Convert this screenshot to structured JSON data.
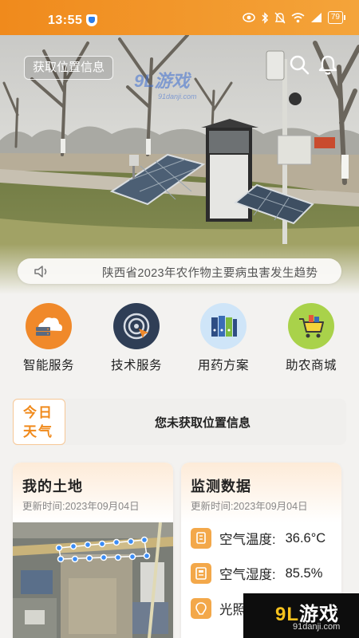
{
  "status_bar": {
    "time": "13:55",
    "battery": "79",
    "icons": [
      "eye-icon",
      "bluetooth-icon",
      "mute-icon",
      "wifi-icon",
      "signal-icon",
      "battery-icon"
    ]
  },
  "hero": {
    "location_button": "获取位置信息",
    "watermark_text": "9L游戏",
    "watermark_url": "91danji.com"
  },
  "notice": {
    "text": "陕西省2023年农作物主要病虫害发生趋势"
  },
  "services": [
    {
      "label": "智能服务",
      "icon": "cloud-server-icon",
      "color": "#f0892a"
    },
    {
      "label": "技术服务",
      "icon": "radar-cursor-icon",
      "color": "#2f3e56"
    },
    {
      "label": "用药方案",
      "icon": "binders-icon",
      "color": "#cfe5f8"
    },
    {
      "label": "助农商城",
      "icon": "shopping-cart-icon",
      "color": "#a9d24a"
    }
  ],
  "weather": {
    "badge_line1": "今日",
    "badge_line2": "天气",
    "message": "您未获取位置信息"
  },
  "my_land": {
    "title": "我的土地",
    "updated": "更新时间:2023年09月04日"
  },
  "monitor": {
    "title": "监测数据",
    "updated": "更新时间:2023年09月04日",
    "metrics": [
      {
        "label": "空气温度:",
        "value": "36.6°C",
        "icon": "thermometer-icon"
      },
      {
        "label": "空气湿度:",
        "value": "85.5%",
        "icon": "humidity-icon"
      },
      {
        "label": "光照",
        "value": "",
        "icon": "light-icon"
      }
    ]
  },
  "watermark": {
    "logo_a": "9L",
    "logo_b": "游戏",
    "url": "91danji.com"
  },
  "colors": {
    "accent": "#f08a1c",
    "background": "#f3f2f0"
  }
}
